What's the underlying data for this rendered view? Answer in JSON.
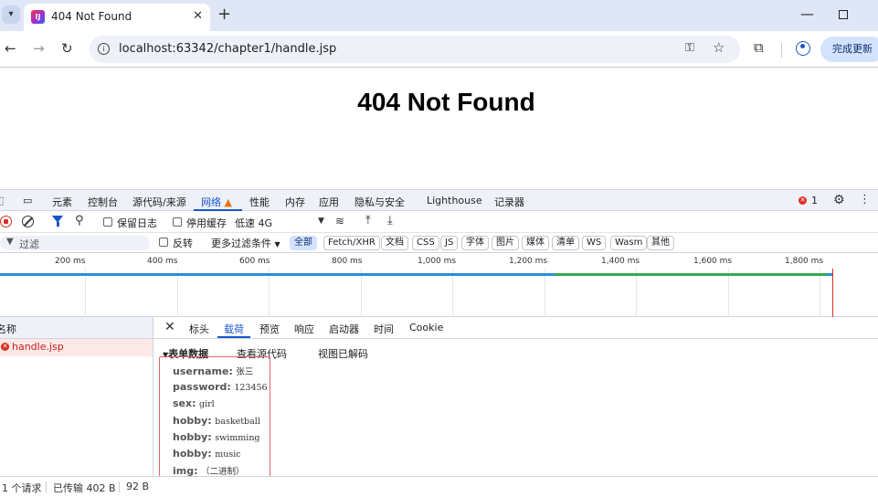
{
  "browser": {
    "tab_title": "404 Not Found",
    "url": "localhost:63342/chapter1/handle.jsp",
    "update_button": "完成更新"
  },
  "page": {
    "heading": "404 Not Found"
  },
  "devtools": {
    "tabs": [
      "元素",
      "控制台",
      "源代码/来源",
      "网络",
      "性能",
      "内存",
      "应用",
      "隐私与安全",
      "Lighthouse",
      "记录器"
    ],
    "active_tab": "网络",
    "error_count": "1",
    "toolbar": {
      "preserve_log": "保留日志",
      "disable_cache": "停用缓存",
      "throttling": "低速 4G"
    },
    "filter": {
      "placeholder": "过滤",
      "invert": "反转",
      "more_filters": "更多过滤条件",
      "types": [
        "全部",
        "Fetch/XHR",
        "文档",
        "CSS",
        "JS",
        "字体",
        "图片",
        "媒体",
        "清单",
        "WS",
        "Wasm",
        "其他"
      ],
      "active_type": "全部"
    },
    "timeline": {
      "ticks": [
        "200 ms",
        "400 ms",
        "600 ms",
        "800 ms",
        "1,000 ms",
        "1,200 ms",
        "1,400 ms",
        "1,600 ms",
        "1,800 ms"
      ]
    },
    "request_list": {
      "header": "名称",
      "requests": [
        {
          "name": "handle.jsp",
          "status": "error"
        }
      ]
    },
    "detail": {
      "tabs": [
        "标头",
        "载荷",
        "预览",
        "响应",
        "启动器",
        "时间",
        "Cookie"
      ],
      "active_tab": "载荷",
      "section_title": "表单数据",
      "view_source": "查看源代码",
      "view_decoded": "视图已解码",
      "form_data": [
        {
          "key": "username:",
          "value": "张三"
        },
        {
          "key": "password:",
          "value": "123456"
        },
        {
          "key": "sex:",
          "value": "girl"
        },
        {
          "key": "hobby:",
          "value": "basketball"
        },
        {
          "key": "hobby:",
          "value": "swimming"
        },
        {
          "key": "hobby:",
          "value": "music"
        },
        {
          "key": "img:",
          "value": "（二进制）"
        }
      ]
    },
    "status": {
      "requests": "1 个请求",
      "transferred": "已传输 402 B",
      "resources": "92 B"
    }
  }
}
